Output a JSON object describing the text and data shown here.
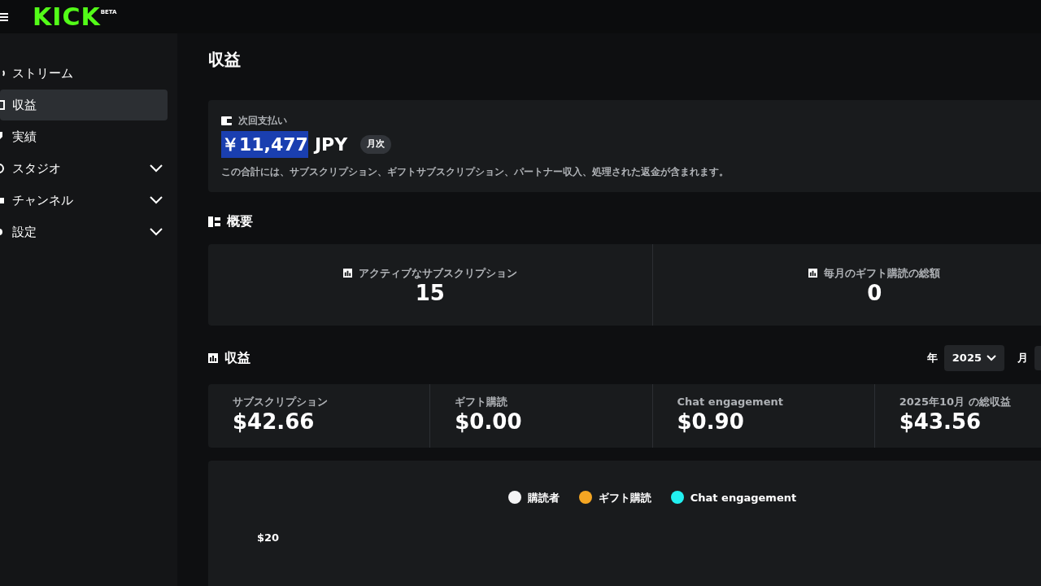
{
  "header": {
    "logo": "KICK",
    "logo_badge": "BETA"
  },
  "sidebar": {
    "items": [
      {
        "label": "ストリーム",
        "kind": "link",
        "selected": false
      },
      {
        "label": "収益",
        "kind": "link",
        "selected": true
      },
      {
        "label": "実績",
        "kind": "link",
        "selected": false
      },
      {
        "label": "スタジオ",
        "kind": "group",
        "selected": false,
        "expanded": false
      },
      {
        "label": "チャンネル",
        "kind": "group",
        "selected": false,
        "expanded": false
      },
      {
        "label": "設定",
        "kind": "group",
        "selected": false,
        "expanded": false
      }
    ]
  },
  "page_title": "収益",
  "payout": {
    "label": "次回支払い",
    "amount": "￥11,477",
    "currency": "JPY",
    "period": "月次",
    "note": "この合計には、サブスクリプション、ギフトサブスクリプション、パートナー収入、処理された返金が含まれます。"
  },
  "overview": {
    "title": "概要",
    "stats": [
      {
        "label": "アクティブなサブスクリプション",
        "value": "15"
      },
      {
        "label": "毎月のギフト購読の総額",
        "value": "0"
      }
    ]
  },
  "revenue": {
    "title": "収益",
    "year_label": "年",
    "year": "2025",
    "month_label": "月",
    "stats": [
      {
        "label": "サブスクリプション",
        "value": "$42.66"
      },
      {
        "label": "ギフト購読",
        "value": "$0.00"
      },
      {
        "label": "Chat engagement",
        "value": "$0.90"
      },
      {
        "label": "2025年10月 の総収益",
        "value": "$43.56"
      }
    ],
    "legend": [
      {
        "label": "購読者",
        "color": "#f4f4f5"
      },
      {
        "label": "ギフト購読",
        "color": "#f5a623"
      },
      {
        "label": "Chat engagement",
        "color": "#22f0f0"
      }
    ],
    "y_tick": "$20"
  }
}
